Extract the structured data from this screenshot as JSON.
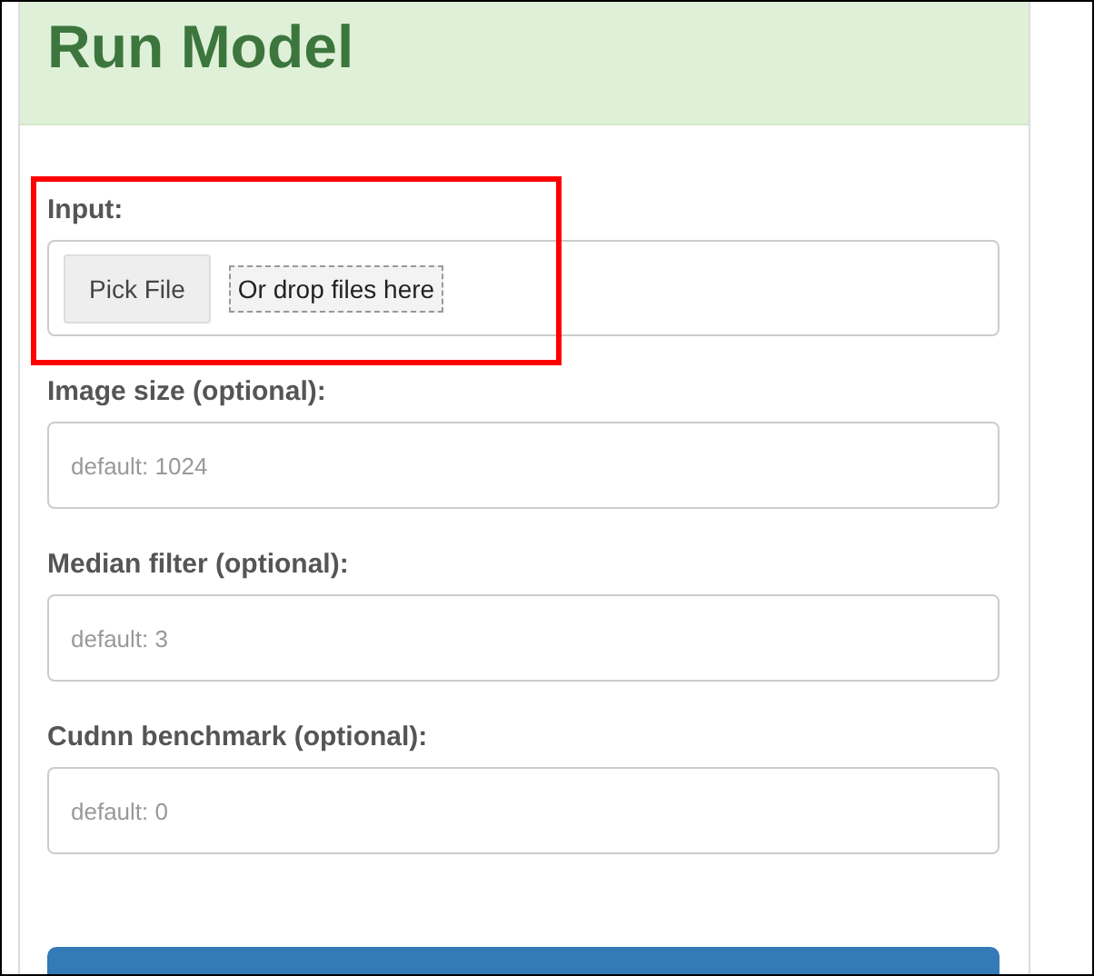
{
  "header": {
    "title": "Run Model"
  },
  "file_input": {
    "label": "Input:",
    "button": "Pick File",
    "drop_zone": "Or drop files here",
    "highlighted": true
  },
  "fields": [
    {
      "label": "Image size (optional):",
      "placeholder": "default: 1024"
    },
    {
      "label": "Median filter (optional):",
      "placeholder": "default: 3"
    },
    {
      "label": "Cudnn benchmark (optional):",
      "placeholder": "default: 0"
    }
  ],
  "submit_button": {
    "kind": "primary"
  }
}
